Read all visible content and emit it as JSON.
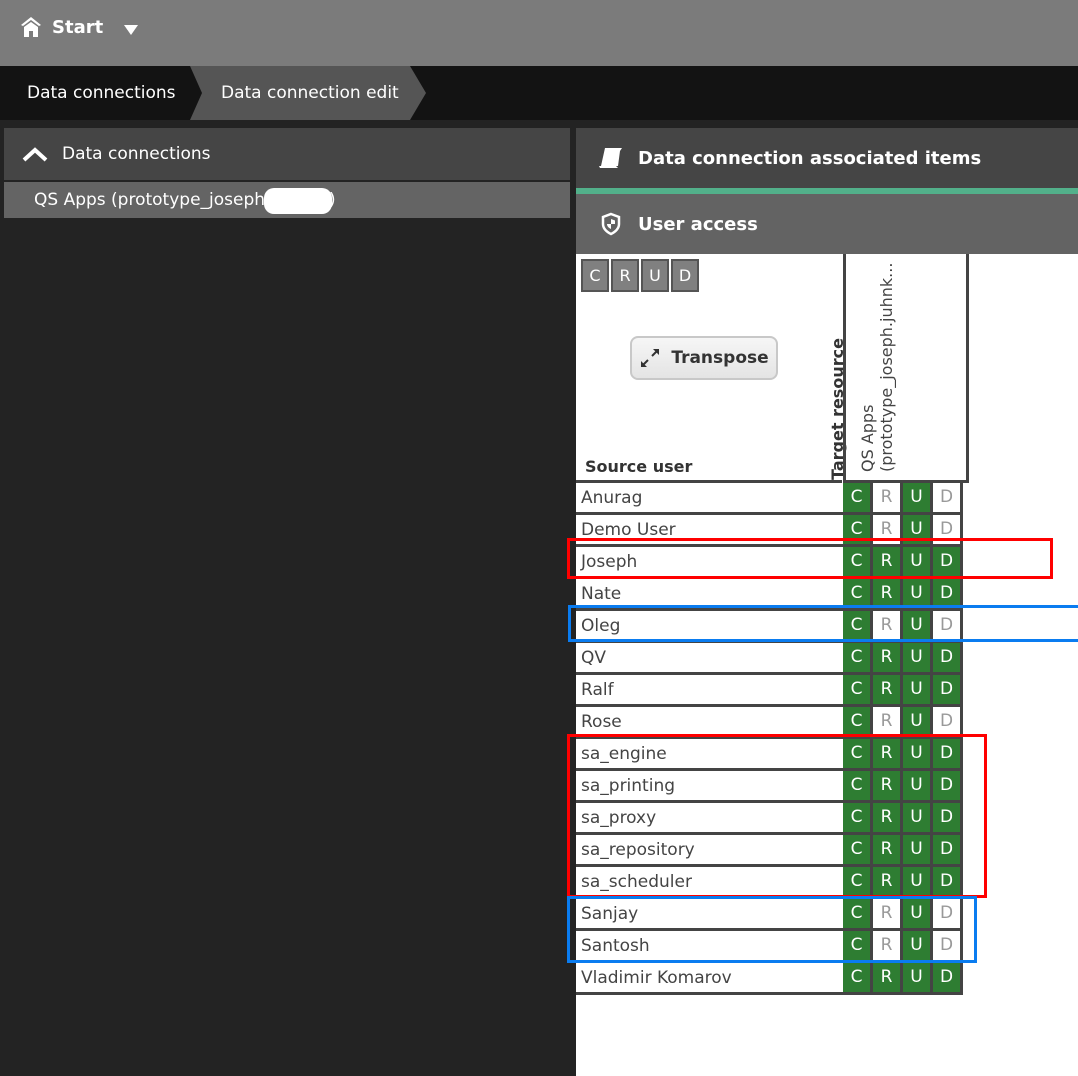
{
  "topbar": {
    "start_label": "Start",
    "home_icon": "home-icon",
    "dropdown_icon": "caret-down-icon"
  },
  "breadcrumb": [
    {
      "label": "Data connections"
    },
    {
      "label": "Data connection edit"
    }
  ],
  "left_panel": {
    "header_label": "Data connections",
    "collapse_icon": "chevron-up-icon",
    "items": [
      {
        "label": "QS Apps (prototype_joseph",
        "suffix": ")"
      }
    ]
  },
  "right_panel": {
    "associated_items_label": "Data connection associated items",
    "user_access_label": "User access",
    "accent_color": "#52b08a"
  },
  "matrix": {
    "legend": [
      "C",
      "R",
      "U",
      "D"
    ],
    "transpose_label": "Transpose",
    "source_label": "Source user",
    "target_label": "Target resource",
    "column_header": "QS Apps (prototype_joseph.juhnk...",
    "column_header_line1": "QS Apps",
    "column_header_line2": "(prototype_joseph.juhnk...",
    "granted_color": "#2e7d32",
    "rows": [
      {
        "user": "Anurag",
        "C": true,
        "R": false,
        "U": true,
        "D": false
      },
      {
        "user": "Demo User",
        "C": true,
        "R": false,
        "U": true,
        "D": false
      },
      {
        "user": "Joseph",
        "C": true,
        "R": true,
        "U": true,
        "D": true
      },
      {
        "user": "Nate",
        "C": true,
        "R": true,
        "U": true,
        "D": true
      },
      {
        "user": "Oleg",
        "C": true,
        "R": false,
        "U": true,
        "D": false
      },
      {
        "user": "QV",
        "C": true,
        "R": true,
        "U": true,
        "D": true
      },
      {
        "user": "Ralf",
        "C": true,
        "R": true,
        "U": true,
        "D": true
      },
      {
        "user": "Rose",
        "C": true,
        "R": false,
        "U": true,
        "D": false
      },
      {
        "user": "sa_engine",
        "C": true,
        "R": true,
        "U": true,
        "D": true
      },
      {
        "user": "sa_printing",
        "C": true,
        "R": true,
        "U": true,
        "D": true
      },
      {
        "user": "sa_proxy",
        "C": true,
        "R": true,
        "U": true,
        "D": true
      },
      {
        "user": "sa_repository",
        "C": true,
        "R": true,
        "U": true,
        "D": true
      },
      {
        "user": "sa_scheduler",
        "C": true,
        "R": true,
        "U": true,
        "D": true
      },
      {
        "user": "Sanjay",
        "C": true,
        "R": false,
        "U": true,
        "D": false
      },
      {
        "user": "Santosh",
        "C": true,
        "R": false,
        "U": true,
        "D": false
      },
      {
        "user": "Vladimir Komarov",
        "C": true,
        "R": true,
        "U": true,
        "D": true
      }
    ]
  },
  "annotations": [
    {
      "name": "highlight-joseph",
      "color": "#ff0000",
      "rows": [
        "Joseph"
      ]
    },
    {
      "name": "highlight-oleg",
      "color": "#0a7cf0",
      "rows": [
        "Oleg"
      ]
    },
    {
      "name": "highlight-service-accounts",
      "color": "#ff0000",
      "rows": [
        "sa_engine",
        "sa_printing",
        "sa_proxy",
        "sa_repository",
        "sa_scheduler"
      ]
    },
    {
      "name": "highlight-sanjay-santosh",
      "color": "#0a7cf0",
      "rows": [
        "Sanjay",
        "Santosh"
      ]
    }
  ]
}
